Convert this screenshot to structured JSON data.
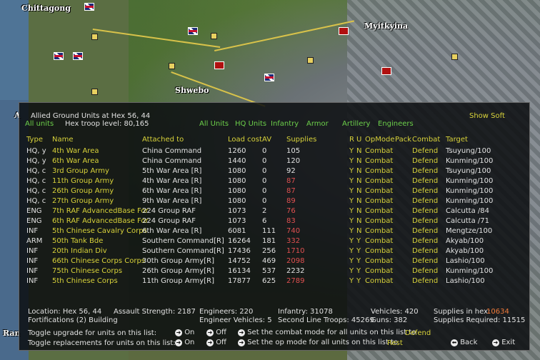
{
  "map": {
    "labels": [
      "Chittagong",
      "Myitkyina",
      "Shwebo",
      "Ran",
      "A"
    ]
  },
  "panel": {
    "title": "Allied Ground Units at Hex 56, 44",
    "all_units_label": "All units",
    "hex_troop_level": "Hex troop level: 80,165",
    "show_soft": "Show Soft",
    "filters": [
      "All Units",
      "HQ Units",
      "Infantry",
      "Armor",
      "Artillery",
      "Engineers"
    ],
    "columns": [
      "Type",
      "Name",
      "Attached to",
      "Load cost",
      "AV",
      "Supplies",
      "R",
      "U",
      "OpMode",
      "Pack",
      "Combat",
      "Target"
    ],
    "rows": [
      {
        "type": "HQ, y",
        "name": "4th War Area",
        "attached": "China Command",
        "load": "1260",
        "av": "0",
        "supplies": "105",
        "sup_color": "w",
        "r": "Y",
        "u": "N",
        "op": "Combat",
        "pack": "",
        "combat": "Defend",
        "target": "Tsuyung/100"
      },
      {
        "type": "HQ, y",
        "name": "6th War Area",
        "attached": "China Command",
        "load": "1440",
        "av": "0",
        "supplies": "120",
        "sup_color": "w",
        "r": "Y",
        "u": "N",
        "op": "Combat",
        "pack": "",
        "combat": "Defend",
        "target": "Kunming/100"
      },
      {
        "type": "HQ, c",
        "name": "3rd Group Army",
        "attached": "5th War Area [R]",
        "load": "1080",
        "av": "0",
        "supplies": "92",
        "sup_color": "w",
        "r": "Y",
        "u": "N",
        "op": "Combat",
        "pack": "",
        "combat": "Defend",
        "target": "Tsuyung/100"
      },
      {
        "type": "HQ, c",
        "name": "11th Group Army",
        "attached": "4th War Area [R]",
        "load": "1080",
        "av": "0",
        "supplies": "87",
        "sup_color": "r",
        "r": "Y",
        "u": "N",
        "op": "Combat",
        "pack": "",
        "combat": "Defend",
        "target": "Kunming/100"
      },
      {
        "type": "HQ, c",
        "name": "26th Group Army",
        "attached": "6th War Area [R]",
        "load": "1080",
        "av": "0",
        "supplies": "87",
        "sup_color": "r",
        "r": "Y",
        "u": "N",
        "op": "Combat",
        "pack": "",
        "combat": "Defend",
        "target": "Kunming/100"
      },
      {
        "type": "HQ, c",
        "name": "27th Group Army",
        "attached": "9th War Area [R]",
        "load": "1080",
        "av": "0",
        "supplies": "89",
        "sup_color": "r",
        "r": "Y",
        "u": "N",
        "op": "Combat",
        "pack": "",
        "combat": "Defend",
        "target": "Kunming/100"
      },
      {
        "type": "ENG",
        "name": "7th RAF AdvancedBase For",
        "attached": "224 Group RAF",
        "load": "1073",
        "av": "2",
        "supplies": "76",
        "sup_color": "r",
        "r": "Y",
        "u": "N",
        "op": "Combat",
        "pack": "",
        "combat": "Defend",
        "target": "Calcutta /84"
      },
      {
        "type": "ENG",
        "name": "6th RAF AdvancedBase For",
        "attached": "224 Group RAF",
        "load": "1073",
        "av": "6",
        "supplies": "83",
        "sup_color": "r",
        "r": "Y",
        "u": "N",
        "op": "Combat",
        "pack": "",
        "combat": "Defend",
        "target": "Calcutta /71"
      },
      {
        "type": "INF",
        "name": "5th Chinese Cavalry Corps",
        "attached": "6th War Area [R]",
        "load": "6081",
        "av": "111",
        "supplies": "740",
        "sup_color": "r",
        "r": "Y",
        "u": "N",
        "op": "Combat",
        "pack": "",
        "combat": "Defend",
        "target": "Mengtze/100"
      },
      {
        "type": "ARM",
        "name": "50th Tank Bde",
        "attached": "Southern Command[R]",
        "load": "16264",
        "av": "181",
        "supplies": "332",
        "sup_color": "r",
        "r": "Y",
        "u": "Y",
        "op": "Combat",
        "pack": "",
        "combat": "Defend",
        "target": "Akyab/100"
      },
      {
        "type": "INF",
        "name": "20th Indian Div",
        "attached": "Southern Command[R]",
        "load": "17436",
        "av": "256",
        "supplies": "1710",
        "sup_color": "r",
        "r": "Y",
        "u": "Y",
        "op": "Combat",
        "pack": "",
        "combat": "Defend",
        "target": "Akyab/100"
      },
      {
        "type": "INF",
        "name": "66th Chinese Corps Corps",
        "attached": "30th Group Army[R]",
        "load": "14752",
        "av": "469",
        "supplies": "2098",
        "sup_color": "r",
        "r": "Y",
        "u": "Y",
        "op": "Combat",
        "pack": "",
        "combat": "Defend",
        "target": "Lashio/100"
      },
      {
        "type": "INF",
        "name": "75th Chinese Corps",
        "attached": "26th Group Army[R]",
        "load": "16134",
        "av": "537",
        "supplies": "2232",
        "sup_color": "w",
        "r": "Y",
        "u": "Y",
        "op": "Combat",
        "pack": "",
        "combat": "Defend",
        "target": "Kunming/100"
      },
      {
        "type": "INF",
        "name": "5th Chinese Corps",
        "attached": "11th Group Army[R]",
        "load": "17877",
        "av": "625",
        "supplies": "2789",
        "sup_color": "r",
        "r": "Y",
        "u": "Y",
        "op": "Combat",
        "pack": "",
        "combat": "Defend",
        "target": "Lashio/100"
      }
    ],
    "summary": {
      "location": "Location: Hex 56, 44",
      "assault_strength": "Assault Strength: 2187",
      "engineers": "Engineers: 220",
      "infantry": "Infantry: 31078",
      "vehicles": "Vehicles: 420",
      "supplies_in_hex_label": "Supplies in hex:",
      "supplies_in_hex_value": "10634",
      "fortifications": "Fortifications (2) Building",
      "engineer_vehicles": "Engineer Vehicles: 5",
      "second_line": "Second Line Troops: 45269",
      "guns": "Guns: 382",
      "supplies_required": "Supplies Required: 11515"
    },
    "toggles": {
      "upgrade_label": "Toggle upgrade for units on this list:",
      "replacements_label": "Toggle replacements for units on this list:",
      "on": "On",
      "off": "Off",
      "combat_mode_label": "Set the combat mode for all units on this list to",
      "combat_mode_value": "Defend",
      "op_mode_label": "Set the op mode for all units on this list to",
      "op_mode_value": "Rest",
      "back": "Back",
      "exit": "Exit"
    }
  }
}
